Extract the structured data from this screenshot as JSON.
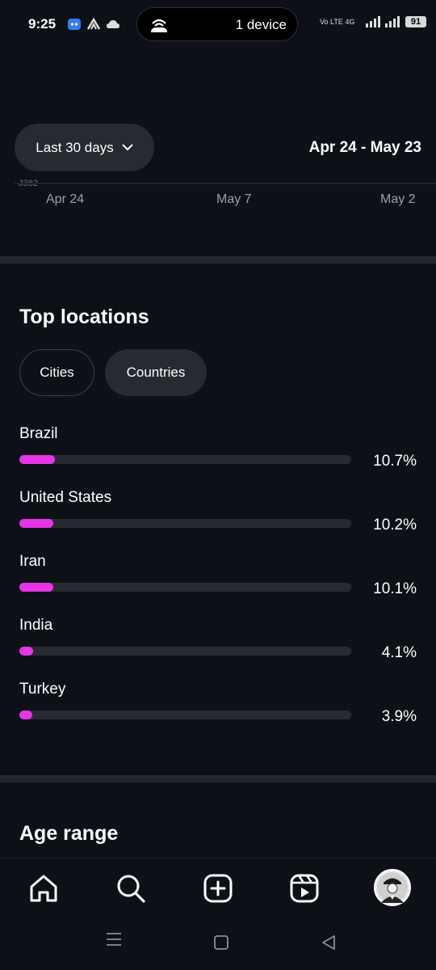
{
  "status_bar": {
    "time": "9:25",
    "device_pill_label": "1 device",
    "network": "Vo LTE 4G",
    "battery": "91"
  },
  "filter": {
    "period_label": "Last 30 days",
    "date_range": "Apr 24 - May 23"
  },
  "chart_axis": {
    "ghost_label": "J382",
    "ticks": [
      "Apr 24",
      "May 7",
      "May 2"
    ]
  },
  "top_locations": {
    "title": "Top locations",
    "tabs": [
      {
        "label": "Cities",
        "selected": false
      },
      {
        "label": "Countries",
        "selected": true
      }
    ],
    "bar_color": "#e535e5",
    "items": [
      {
        "name": "Brazil",
        "percent_label": "10.7%",
        "value": 10.7
      },
      {
        "name": "United States",
        "percent_label": "10.2%",
        "value": 10.2
      },
      {
        "name": "Iran",
        "percent_label": "10.1%",
        "value": 10.1
      },
      {
        "name": "India",
        "percent_label": "4.1%",
        "value": 4.1
      },
      {
        "name": "Turkey",
        "percent_label": "3.9%",
        "value": 3.9
      }
    ]
  },
  "age_range": {
    "title": "Age range"
  },
  "bottom_nav": {
    "items": [
      "home-icon",
      "search-icon",
      "create-icon",
      "reels-icon",
      "profile-avatar"
    ]
  },
  "system_nav": {
    "items": [
      "recents-icon",
      "home-square-icon",
      "back-icon"
    ]
  }
}
